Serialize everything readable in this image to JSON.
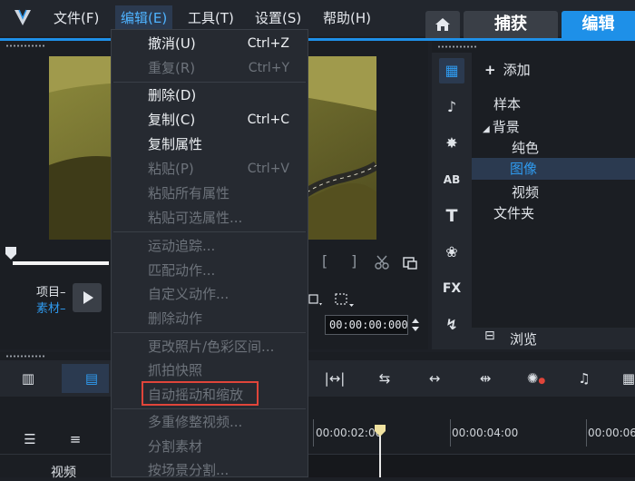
{
  "menubar": {
    "items": [
      {
        "label": "文件(F)"
      },
      {
        "label": "编辑(E)"
      },
      {
        "label": "工具(T)"
      },
      {
        "label": "设置(S)"
      },
      {
        "label": "帮助(H)"
      }
    ]
  },
  "tabs": {
    "home_icon": "home-icon",
    "capture": "捕获",
    "edit": "编辑"
  },
  "player": {
    "project_label": "项目–",
    "clip_label": "素材–",
    "timecode": "00:00:00:000",
    "mark_in": "[",
    "mark_out": "]"
  },
  "library": {
    "add_label": "添加",
    "tree": [
      "样本",
      "背景",
      "纯色",
      "图像",
      "视频",
      "文件夹"
    ],
    "selected": "图像",
    "browse_label": "浏览",
    "icons": [
      "media-icon",
      "audio-icon",
      "transition-icon",
      "title-ab-icon",
      "text-icon",
      "graphics-icon",
      "fx-icon",
      "path-icon"
    ]
  },
  "timeline": {
    "ruler": [
      "00:00:02:00",
      "00:00:04:00",
      "00:00:06"
    ],
    "track_label": "视频"
  },
  "edit_menu": {
    "items": [
      {
        "label": "撤消(U)",
        "shortcut": "Ctrl+Z",
        "enabled": true
      },
      {
        "label": "重复(R)",
        "shortcut": "Ctrl+Y",
        "enabled": false
      },
      {
        "label": "删除(D)",
        "shortcut": "",
        "enabled": true
      },
      {
        "label": "复制(C)",
        "shortcut": "Ctrl+C",
        "enabled": true
      },
      {
        "label": "复制属性",
        "shortcut": "",
        "enabled": true
      },
      {
        "label": "粘贴(P)",
        "shortcut": "Ctrl+V",
        "enabled": false
      },
      {
        "label": "粘贴所有属性",
        "shortcut": "",
        "enabled": false
      },
      {
        "label": "粘贴可选属性...",
        "shortcut": "",
        "enabled": false
      },
      {
        "label": "运动追踪...",
        "shortcut": "",
        "enabled": false
      },
      {
        "label": "匹配动作...",
        "shortcut": "",
        "enabled": false
      },
      {
        "label": "自定义动作...",
        "shortcut": "",
        "enabled": false
      },
      {
        "label": "删除动作",
        "shortcut": "",
        "enabled": false
      },
      {
        "label": "更改照片/色彩区间...",
        "shortcut": "",
        "enabled": false
      },
      {
        "label": "抓拍快照",
        "shortcut": "",
        "enabled": false
      },
      {
        "label": "自动摇动和缩放",
        "shortcut": "",
        "enabled": false
      },
      {
        "label": "多重修整视频...",
        "shortcut": "",
        "enabled": false
      },
      {
        "label": "分割素材",
        "shortcut": "",
        "enabled": false
      },
      {
        "label": "按场景分割...",
        "shortcut": "",
        "enabled": false
      }
    ]
  },
  "colors": {
    "accent": "#1e90e8",
    "highlight_box": "#e0453a"
  }
}
